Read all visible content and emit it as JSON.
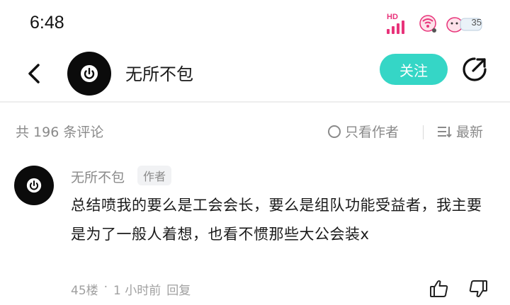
{
  "status_bar": {
    "time": "6:48",
    "signal_label": "HD",
    "battery_level": "35",
    "accent_color": "#e8337a"
  },
  "nav": {
    "title": "无所不包",
    "follow_label": "关注",
    "follow_color": "#35d6c6",
    "back_icon": "chevron-left-icon",
    "share_icon": "share-icon"
  },
  "filters": {
    "comment_count": "共 196 条评论",
    "author_only_label": "只看作者",
    "sort_label": "最新"
  },
  "comment": {
    "author": "无所不包",
    "badge": "作者",
    "text": "总结喷我的要么是工会会长，要么是组队功能受益者，我主要是为了一般人着想，也看不惯那些大公会装x",
    "floor": "45楼",
    "separator": "·",
    "time": "1 小时前",
    "reply_label": "回复",
    "like_icon": "thumbs-up-icon",
    "dislike_icon": "thumbs-down-icon"
  }
}
